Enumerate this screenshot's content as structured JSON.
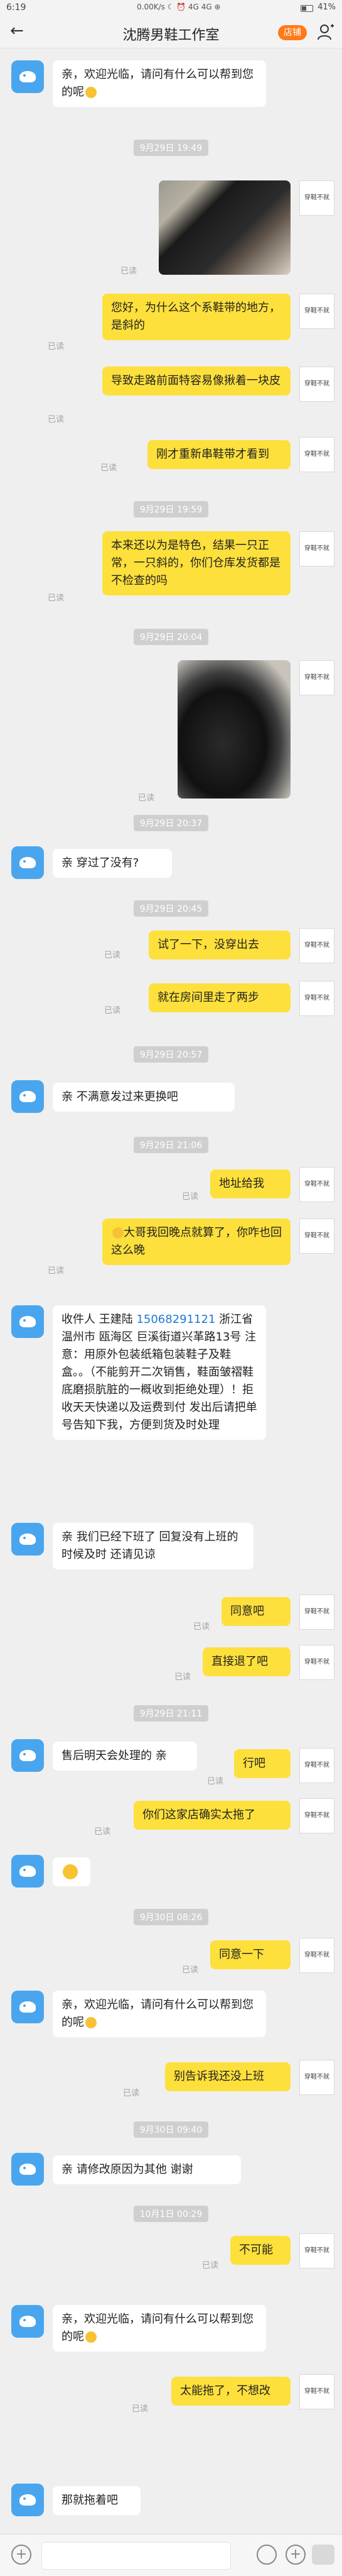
{
  "status": {
    "time": "6:19",
    "net": "0.00K/s ☾ ⏰ 4G 4G ⊕",
    "battery": "41%"
  },
  "header": {
    "title": "沈腾男鞋工作室",
    "shop_label": "店铺"
  },
  "read_label": "已读",
  "user_avatar_text": "穿鞋不就",
  "user_avatar_sub": "",
  "messages": {
    "m1": "亲，欢迎光临，请问有什么可以帮到您的呢",
    "t1": "9月29日 19:49",
    "m2": "您好，为什么这个系鞋带的地方，是斜的",
    "m3": "导致走路前面特容易像揪着一块皮",
    "m4": "刚才重新串鞋带才看到",
    "t2": "9月29日 19:59",
    "m5": "本来还以为是特色，结果一只正常，一只斜的，你们仓库发货都是不检查的吗",
    "t3": "9月29日 20:04",
    "t4": "9月29日 20:37",
    "m6": "亲 穿过了没有?",
    "t5": "9月29日 20:45",
    "m7": "试了一下，没穿出去",
    "m8": "就在房间里走了两步",
    "t6": "9月29日 20:57",
    "m9": "亲 不满意发过来更换吧",
    "t7": "9月29日 21:06",
    "m10": "地址给我",
    "m11": "大哥我回晚点就算了，你咋也回这么晚",
    "m12_name": "收件人 王建陆 ",
    "m12_phone": "15068291121",
    "m12_rest": " 浙江省 温州市 瓯海区 巨溪街道兴革路13号 注意：用原外包装纸箱包装鞋子及鞋盒。。（不能剪开二次销售，鞋面皱褶鞋底磨损肮脏的一概收到拒绝处理）！拒收天天快递以及运费到付 发出后请把单号告知下我，方便到货及时处理",
    "m13": "亲 我们已经下班了 回复没有上班的时候及时 还请见谅",
    "m14": "同意吧",
    "m15": "直接退了吧",
    "t8": "9月29日 21:11",
    "m16": "售后明天会处理的 亲",
    "m17": "行吧",
    "m18": "你们这家店确实太拖了",
    "t9": "9月30日 08:26",
    "m19": "同意一下",
    "m20": "亲，欢迎光临，请问有什么可以帮到您的呢",
    "m21": "别告诉我还没上班",
    "t10": "9月30日 09:40",
    "m22": "亲 请修改原因为其他 谢谢",
    "t11": "10月1日 00:29",
    "m23": "不可能",
    "m24": "亲，欢迎光临，请问有什么可以帮到您的呢",
    "m25": "太能拖了，不想改",
    "m26": "那就拖着吧"
  }
}
